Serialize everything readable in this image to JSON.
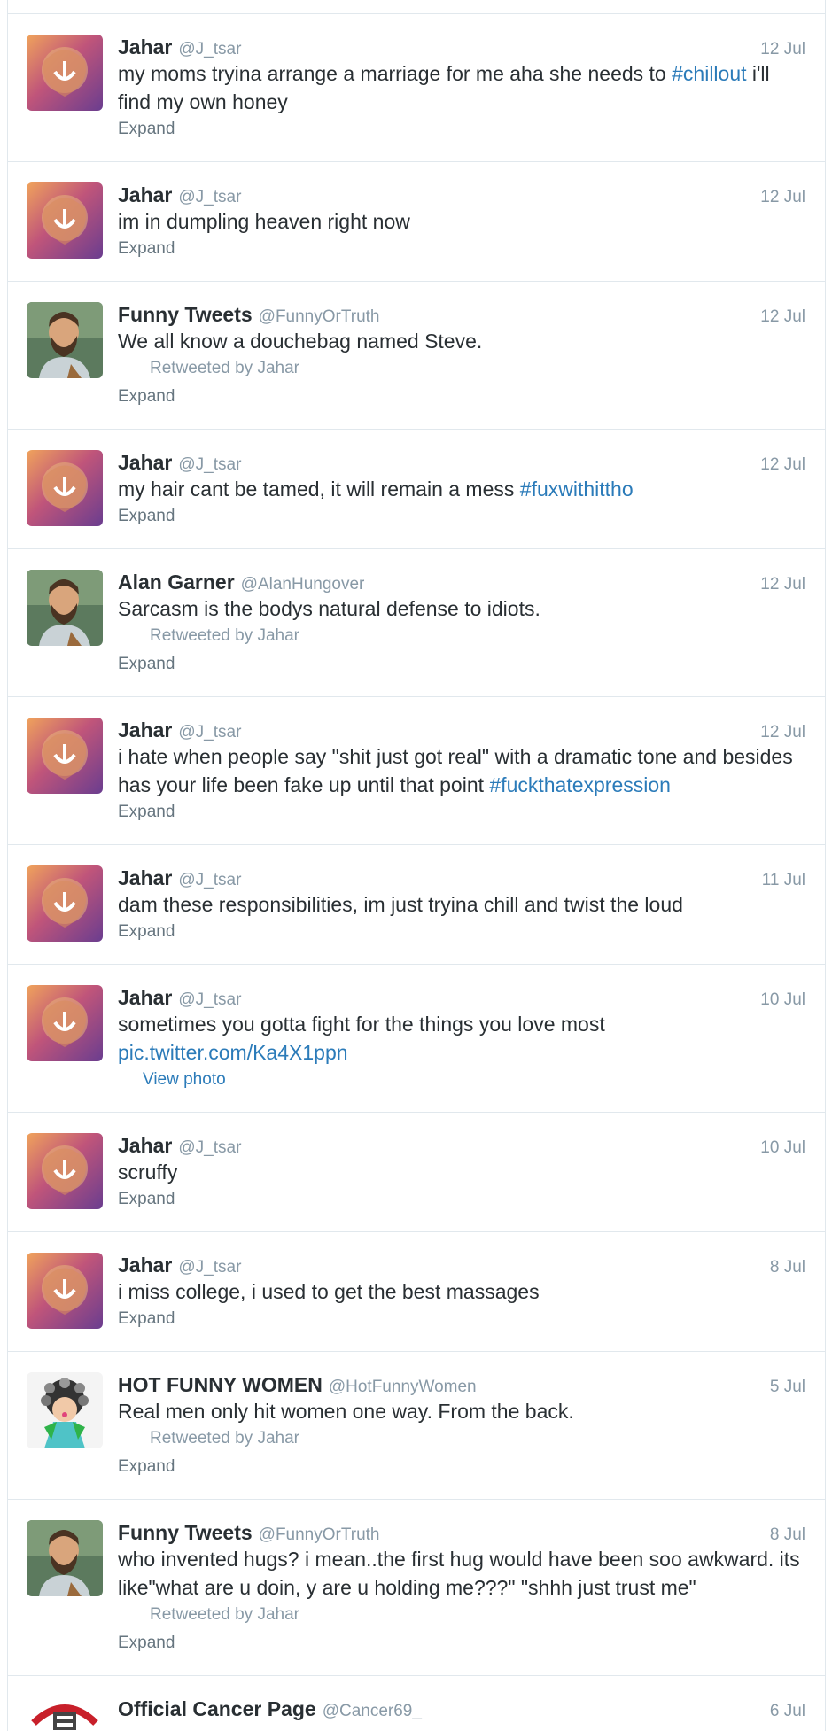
{
  "colors": {
    "link": "#2b7bb9",
    "meta": "#8899a6",
    "text": "#292f33",
    "border": "#e1e8ed"
  },
  "tweets": [
    {
      "avatar": "jahar-lion-avatar",
      "name": "Jahar",
      "handle": "@J_tsar",
      "time": "12 Jul",
      "text_parts": [
        "my moms tryina arrange a marriage for me aha she needs to ",
        "#chillout",
        " i'll find my own honey"
      ],
      "action": "Expand"
    },
    {
      "avatar": "jahar-lion-avatar",
      "name": "Jahar",
      "handle": "@J_tsar",
      "time": "12 Jul",
      "text": "im in dumpling heaven right now",
      "action": "Expand"
    },
    {
      "avatar": "bearded-man-avatar",
      "name": "Funny Tweets",
      "handle": "@FunnyOrTruth",
      "time": "12 Jul",
      "text": "We all know a douchebag named Steve.",
      "retweet": "Retweeted by Jahar",
      "action": "Expand"
    },
    {
      "avatar": "jahar-lion-avatar",
      "name": "Jahar",
      "handle": "@J_tsar",
      "time": "12 Jul",
      "text_parts": [
        "my hair cant be tamed, it will remain a mess ",
        "#fuxwithittho",
        ""
      ],
      "action": "Expand"
    },
    {
      "avatar": "bearded-man-avatar",
      "name": "Alan Garner",
      "handle": "@AlanHungover",
      "time": "12 Jul",
      "text": "Sarcasm is the bodys natural defense to idiots.",
      "retweet": "Retweeted by Jahar",
      "action": "Expand"
    },
    {
      "avatar": "jahar-lion-avatar",
      "name": "Jahar",
      "handle": "@J_tsar",
      "time": "12 Jul",
      "text_parts": [
        "i hate when people say \"shit just got real\" with a dramatic tone and besides has your life been fake up until that point ",
        "#fuckthatexpression",
        ""
      ],
      "action": "Expand"
    },
    {
      "avatar": "jahar-lion-avatar",
      "name": "Jahar",
      "handle": "@J_tsar",
      "time": "11 Jul",
      "text": "dam these responsibilities, im just tryina chill and twist the loud",
      "action": "Expand"
    },
    {
      "avatar": "jahar-lion-avatar",
      "name": "Jahar",
      "handle": "@J_tsar",
      "time": "10 Jul",
      "text": "sometimes you gotta fight for the things you love most",
      "link": "pic.twitter.com/Ka4X1ppn",
      "photo_action": "View photo"
    },
    {
      "avatar": "jahar-lion-avatar",
      "name": "Jahar",
      "handle": "@J_tsar",
      "time": "10 Jul",
      "text": "scruffy",
      "action": "Expand"
    },
    {
      "avatar": "jahar-lion-avatar",
      "name": "Jahar",
      "handle": "@J_tsar",
      "time": "8 Jul",
      "text": "i miss college, i used to get the best massages",
      "action": "Expand"
    },
    {
      "avatar": "woman-curlers-avatar",
      "name": "HOT FUNNY WOMEN",
      "handle": "@HotFunnyWomen",
      "time": "5 Jul",
      "text": "Real men only hit women one way. From the back.",
      "retweet": "Retweeted by Jahar",
      "action": "Expand"
    },
    {
      "avatar": "bearded-man-avatar",
      "name": "Funny Tweets",
      "handle": "@FunnyOrTruth",
      "time": "8 Jul",
      "text": "who invented hugs? i mean..the first hug would have been soo awkward. its like\"what are u doin, y are u holding me???\" \"shhh just trust me\"",
      "retweet": "Retweeted by Jahar",
      "action": "Expand"
    },
    {
      "avatar": "cancer-page-avatar",
      "name": "Official Cancer Page",
      "handle": "@Cancer69_",
      "time": "6 Jul"
    }
  ]
}
